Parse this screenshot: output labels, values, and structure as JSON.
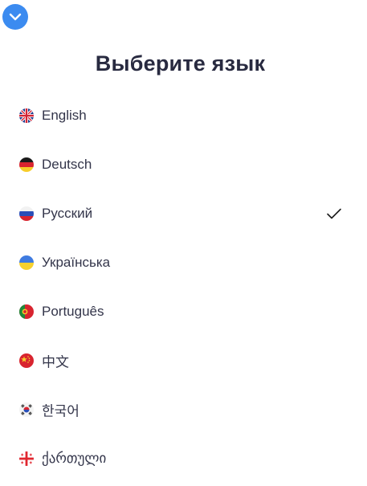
{
  "header": {
    "collapse_icon": "chevron-down-icon",
    "accent_color": "#3b8bf0",
    "title": "Выберите язык"
  },
  "languages": [
    {
      "label": "English",
      "flag": "uk-flag-icon",
      "selected": false
    },
    {
      "label": "Deutsch",
      "flag": "germany-flag-icon",
      "selected": false
    },
    {
      "label": "Русский",
      "flag": "russia-flag-icon",
      "selected": true
    },
    {
      "label": "Українська",
      "flag": "ukraine-flag-icon",
      "selected": false
    },
    {
      "label": "Português",
      "flag": "portugal-flag-icon",
      "selected": false
    },
    {
      "label": "中文",
      "flag": "china-flag-icon",
      "selected": false
    },
    {
      "label": "한국어",
      "flag": "korea-flag-icon",
      "selected": false
    },
    {
      "label": "ქართული",
      "flag": "georgia-flag-icon",
      "selected": false
    }
  ],
  "selected_icon": "checkmark-icon"
}
